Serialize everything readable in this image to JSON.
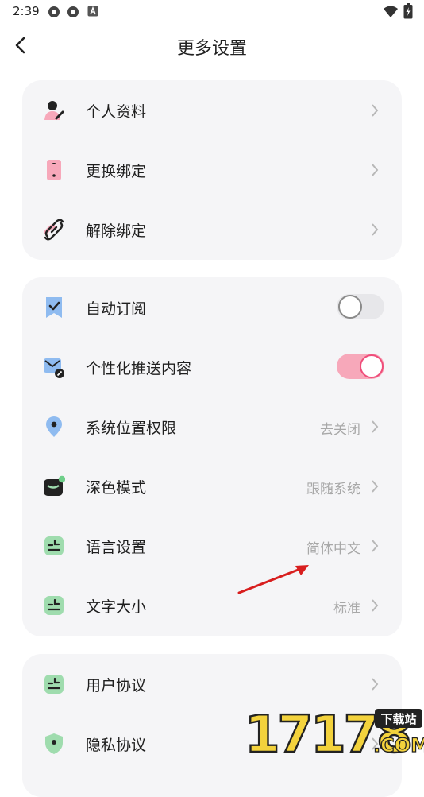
{
  "status_bar": {
    "time": "2:39"
  },
  "header": {
    "title": "更多设置"
  },
  "group1": {
    "items": [
      {
        "label": "个人资料",
        "icon": "profile-icon"
      },
      {
        "label": "更换绑定",
        "icon": "phone-icon"
      },
      {
        "label": "解除绑定",
        "icon": "unlink-icon"
      }
    ]
  },
  "group2": {
    "items": [
      {
        "label": "自动订阅",
        "icon": "bookmark-check-icon",
        "toggle": false
      },
      {
        "label": "个性化推送内容",
        "icon": "mail-edit-icon",
        "toggle": true
      },
      {
        "label": "系统位置权限",
        "value": "去关闭",
        "icon": "location-pin-icon"
      },
      {
        "label": "深色模式",
        "value": "跟随系统",
        "icon": "dark-mode-icon"
      },
      {
        "label": "语言设置",
        "value": "简体中文",
        "icon": "language-doc-icon"
      },
      {
        "label": "文字大小",
        "value": "标准",
        "icon": "text-size-doc-icon"
      }
    ]
  },
  "group3": {
    "items": [
      {
        "label": "用户协议",
        "icon": "agreement-doc-icon"
      },
      {
        "label": "隐私协议",
        "icon": "privacy-shield-icon"
      }
    ]
  },
  "watermark": {
    "number": "17178",
    "tag": "下载站",
    "suffix": ".COM"
  },
  "colors": {
    "accent": "#ef4d7a",
    "toggle_on_track": "#f7a8ba",
    "card_bg": "#f5f5f7",
    "icon_pink": "#f7a8ba",
    "icon_blue": "#8fbbf0",
    "icon_green": "#9fdcae",
    "annotation_arrow": "#d81e1e"
  }
}
